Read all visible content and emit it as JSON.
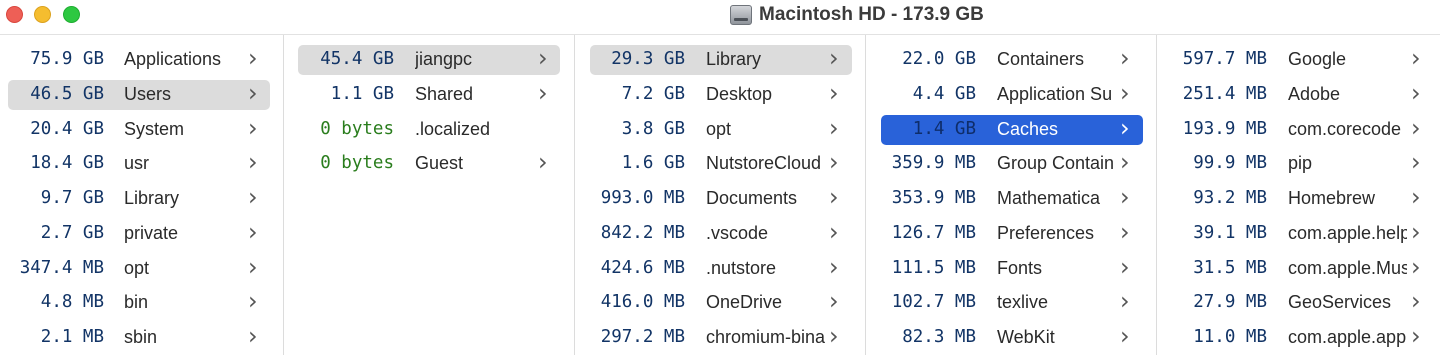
{
  "window": {
    "title": "Macintosh HD - 173.9 GB",
    "icon": "hard-drive-icon"
  },
  "columns": [
    {
      "rows": [
        {
          "size": "75.9 GB",
          "name": "Applications",
          "state": "none"
        },
        {
          "size": "46.5 GB",
          "name": "Users",
          "state": "gray"
        },
        {
          "size": "20.4 GB",
          "name": "System",
          "state": "none"
        },
        {
          "size": "18.4 GB",
          "name": "usr",
          "state": "none"
        },
        {
          "size": "9.7 GB",
          "name": "Library",
          "state": "none"
        },
        {
          "size": "2.7 GB",
          "name": "private",
          "state": "none"
        },
        {
          "size": "347.4 MB",
          "name": "opt",
          "state": "none"
        },
        {
          "size": "4.8 MB",
          "name": "bin",
          "state": "none"
        },
        {
          "size": "2.1 MB",
          "name": "sbin",
          "state": "none"
        }
      ]
    },
    {
      "rows": [
        {
          "size": "45.4 GB",
          "name": "jiangpc",
          "state": "gray"
        },
        {
          "size": "1.1 GB",
          "name": "Shared",
          "state": "none"
        },
        {
          "size": "0 bytes",
          "name": ".localized",
          "state": "none",
          "zero": true,
          "noArrow": true
        },
        {
          "size": "0 bytes",
          "name": "Guest",
          "state": "none",
          "zero": true
        }
      ]
    },
    {
      "rows": [
        {
          "size": "29.3 GB",
          "name": "Library",
          "state": "gray"
        },
        {
          "size": "7.2 GB",
          "name": "Desktop",
          "state": "none"
        },
        {
          "size": "3.8 GB",
          "name": "opt",
          "state": "none"
        },
        {
          "size": "1.6 GB",
          "name": "NutstoreCloud",
          "state": "none"
        },
        {
          "size": "993.0 MB",
          "name": "Documents",
          "state": "none"
        },
        {
          "size": "842.2 MB",
          "name": ".vscode",
          "state": "none"
        },
        {
          "size": "424.6 MB",
          "name": ".nutstore",
          "state": "none"
        },
        {
          "size": "416.0 MB",
          "name": "OneDrive",
          "state": "none"
        },
        {
          "size": "297.2 MB",
          "name": "chromium-bina",
          "state": "none"
        }
      ]
    },
    {
      "rows": [
        {
          "size": "22.0 GB",
          "name": "Containers",
          "state": "none"
        },
        {
          "size": "4.4 GB",
          "name": "Application Su",
          "state": "none"
        },
        {
          "size": "1.4 GB",
          "name": "Caches",
          "state": "blue"
        },
        {
          "size": "359.9 MB",
          "name": "Group Contain",
          "state": "none"
        },
        {
          "size": "353.9 MB",
          "name": "Mathematica",
          "state": "none"
        },
        {
          "size": "126.7 MB",
          "name": "Preferences",
          "state": "none"
        },
        {
          "size": "111.5 MB",
          "name": "Fonts",
          "state": "none"
        },
        {
          "size": "102.7 MB",
          "name": "texlive",
          "state": "none"
        },
        {
          "size": "82.3 MB",
          "name": "WebKit",
          "state": "none"
        }
      ]
    },
    {
      "rows": [
        {
          "size": "597.7 MB",
          "name": "Google",
          "state": "none"
        },
        {
          "size": "251.4 MB",
          "name": "Adobe",
          "state": "none"
        },
        {
          "size": "193.9 MB",
          "name": "com.corecode",
          "state": "none"
        },
        {
          "size": "99.9 MB",
          "name": "pip",
          "state": "none"
        },
        {
          "size": "93.2 MB",
          "name": "Homebrew",
          "state": "none"
        },
        {
          "size": "39.1 MB",
          "name": "com.apple.help",
          "state": "none"
        },
        {
          "size": "31.5 MB",
          "name": "com.apple.Mus",
          "state": "none"
        },
        {
          "size": "27.9 MB",
          "name": "GeoServices",
          "state": "none"
        },
        {
          "size": "11.0 MB",
          "name": "com.apple.app",
          "state": "none"
        }
      ]
    }
  ],
  "colors": {
    "selection_gray": "#dcdcdc",
    "selection_blue": "#2962d9",
    "size_text": "#123466",
    "zero_size_text": "#2a7d1d"
  }
}
